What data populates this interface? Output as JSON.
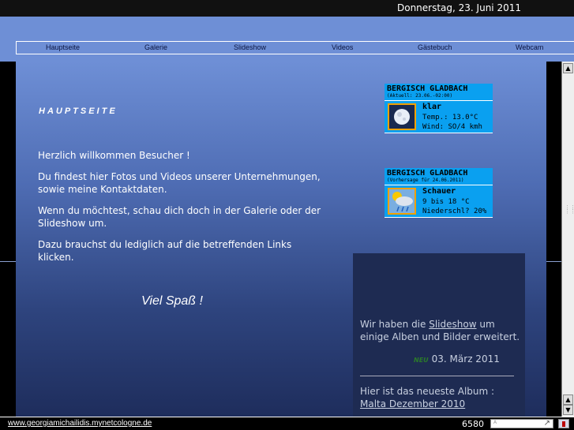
{
  "topbar": {
    "date": "Donnerstag, 23. Juni 2011"
  },
  "nav": {
    "items": [
      "Hauptseite",
      "Galerie",
      "Slideshow",
      "Videos",
      "Gästebuch",
      "Webcam"
    ]
  },
  "main": {
    "title": "HAUPTSEITE",
    "p1": "Herzlich willkommen Besucher !",
    "p2": "Du findest hier Fotos und Videos unserer Unternehmungen, sowie meine Kontaktdaten.",
    "p3": "Wenn du möchtest, schau dich doch in der Galerie oder der Slideshow um.",
    "p4": "Dazu brauchst du lediglich auf die betreffenden Links klicken.",
    "fun": "Viel Spaß !"
  },
  "weather": [
    {
      "city": "BERGISCH GLADBACH",
      "sub": "(Aktuell: 23.06.-02:00)",
      "cond": "klar",
      "line2": "Temp.: 13.0°C",
      "line3": "Wind: SO/4 kmh",
      "icon": "moon-clear-icon"
    },
    {
      "city": "BERGISCH GLADBACH",
      "sub": "(Vorhersage für 24.06.2011)",
      "cond": "Schauer",
      "line2": "9 bis 18 °C",
      "line3": "Niederschl? 20%",
      "icon": "sun-rain-icon"
    }
  ],
  "news": {
    "pre": "Wir haben die ",
    "link": "Slideshow",
    "post": " um einige Alben und Bilder erweitert.",
    "badge": "NEU",
    "date": "03. März 2011",
    "album_text": "Hier ist das neueste Album :",
    "album_link": "Malta Dezember 2010"
  },
  "footer": {
    "site": "www.georgiamichailidis.mynetcologne.de",
    "counter": "6580",
    "field_placeholder": "A"
  },
  "colors": {
    "header": "#6e8fd6",
    "weather_bg": "#0aa0f0",
    "news_bg": "#1e2b52"
  }
}
